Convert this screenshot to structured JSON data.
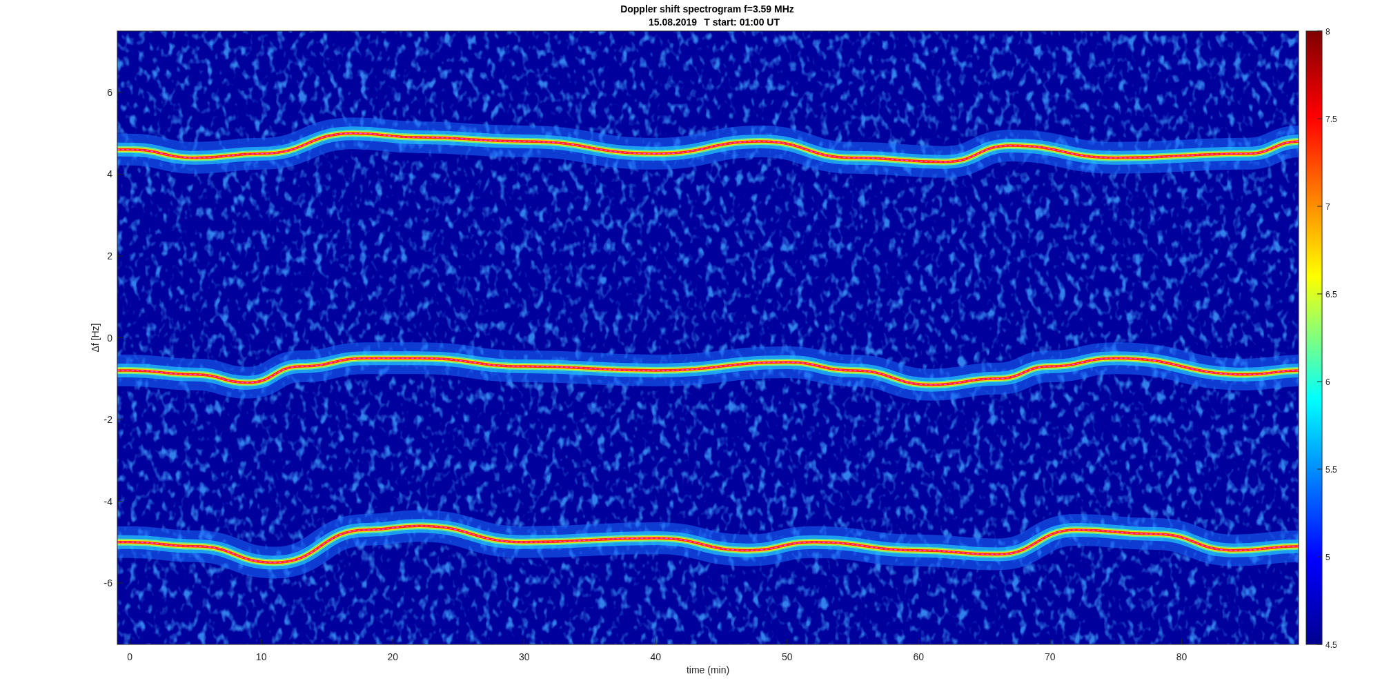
{
  "title": "Doppler shift spectrogram f=3.59 MHz",
  "subtitle": [
    "15.08.2019",
    "T start: 01:00 UT"
  ],
  "x_axis": {
    "label": "time (min)",
    "ticks": [
      "0",
      "10",
      "20",
      "30",
      "40",
      "50",
      "60",
      "70",
      "80"
    ]
  },
  "y_axis": {
    "label": "Δf [Hz]",
    "ticks": [
      "6",
      "4",
      "2",
      "0",
      "-2",
      "-4",
      "-6"
    ]
  },
  "colorbar": {
    "ticks": [
      "8",
      "7.5",
      "7",
      "6.5",
      "6",
      "5.5",
      "5",
      "4.5"
    ]
  }
}
